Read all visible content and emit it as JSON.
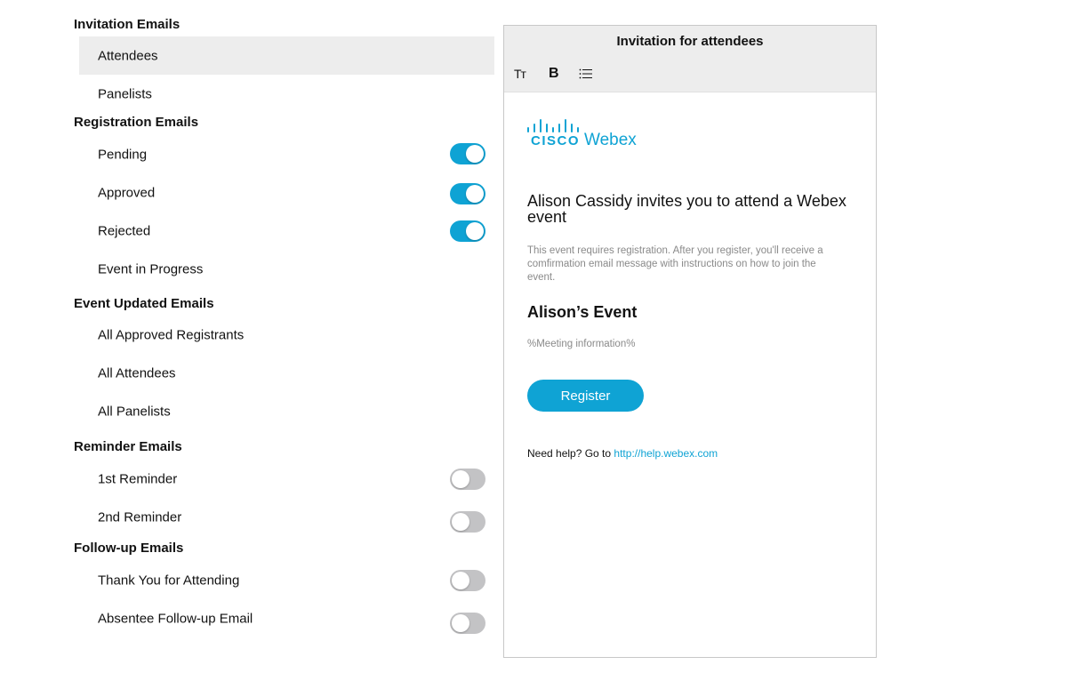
{
  "sections": {
    "invitation": {
      "heading": "Invitation Emails",
      "items": [
        {
          "label": "Attendees",
          "selected": true
        },
        {
          "label": "Panelists"
        }
      ]
    },
    "registration": {
      "heading": "Registration Emails",
      "items": [
        {
          "label": "Pending",
          "toggle": "on"
        },
        {
          "label": "Approved",
          "toggle": "on"
        },
        {
          "label": "Rejected",
          "toggle": "on"
        },
        {
          "label": "Event in Progress"
        }
      ]
    },
    "event_updated": {
      "heading": "Event Updated Emails",
      "items": [
        {
          "label": "All Approved Registrants"
        },
        {
          "label": "All Attendees"
        },
        {
          "label": "All Panelists"
        }
      ]
    },
    "reminder": {
      "heading": "Reminder Emails",
      "items": [
        {
          "label": "1st Reminder",
          "toggle": "off"
        },
        {
          "label": "2nd Reminder",
          "toggle": "off"
        }
      ]
    },
    "follow_up": {
      "heading": "Follow-up Emails",
      "items": [
        {
          "label": "Thank You for Attending",
          "toggle": "off"
        },
        {
          "label": "Absentee Follow-up Email",
          "toggle": "off"
        }
      ]
    }
  },
  "preview": {
    "title": "Invitation for attendees",
    "toolbar": {
      "text_size_icon": "Tт",
      "bold_icon": "B",
      "list_icon": "list-icon"
    },
    "logo": {
      "cisco": "CISCO",
      "webex": "Webex"
    },
    "invite_line": "Alison Cassidy invites you to attend a Webex event",
    "registration_note": "This event requires registration. After you register, you'll receive a comfirmation email message with instructions on how to join the event.",
    "event_name": "Alison’s Event",
    "meeting_info": "%Meeting information%",
    "register_label": "Register",
    "help_prefix": "Need help? Go to",
    "help_link": "http://help.webex.com"
  },
  "colors": {
    "accent": "#0fa3d4",
    "toggle_off": "#c3c3c5",
    "selected_row": "#ededed"
  }
}
